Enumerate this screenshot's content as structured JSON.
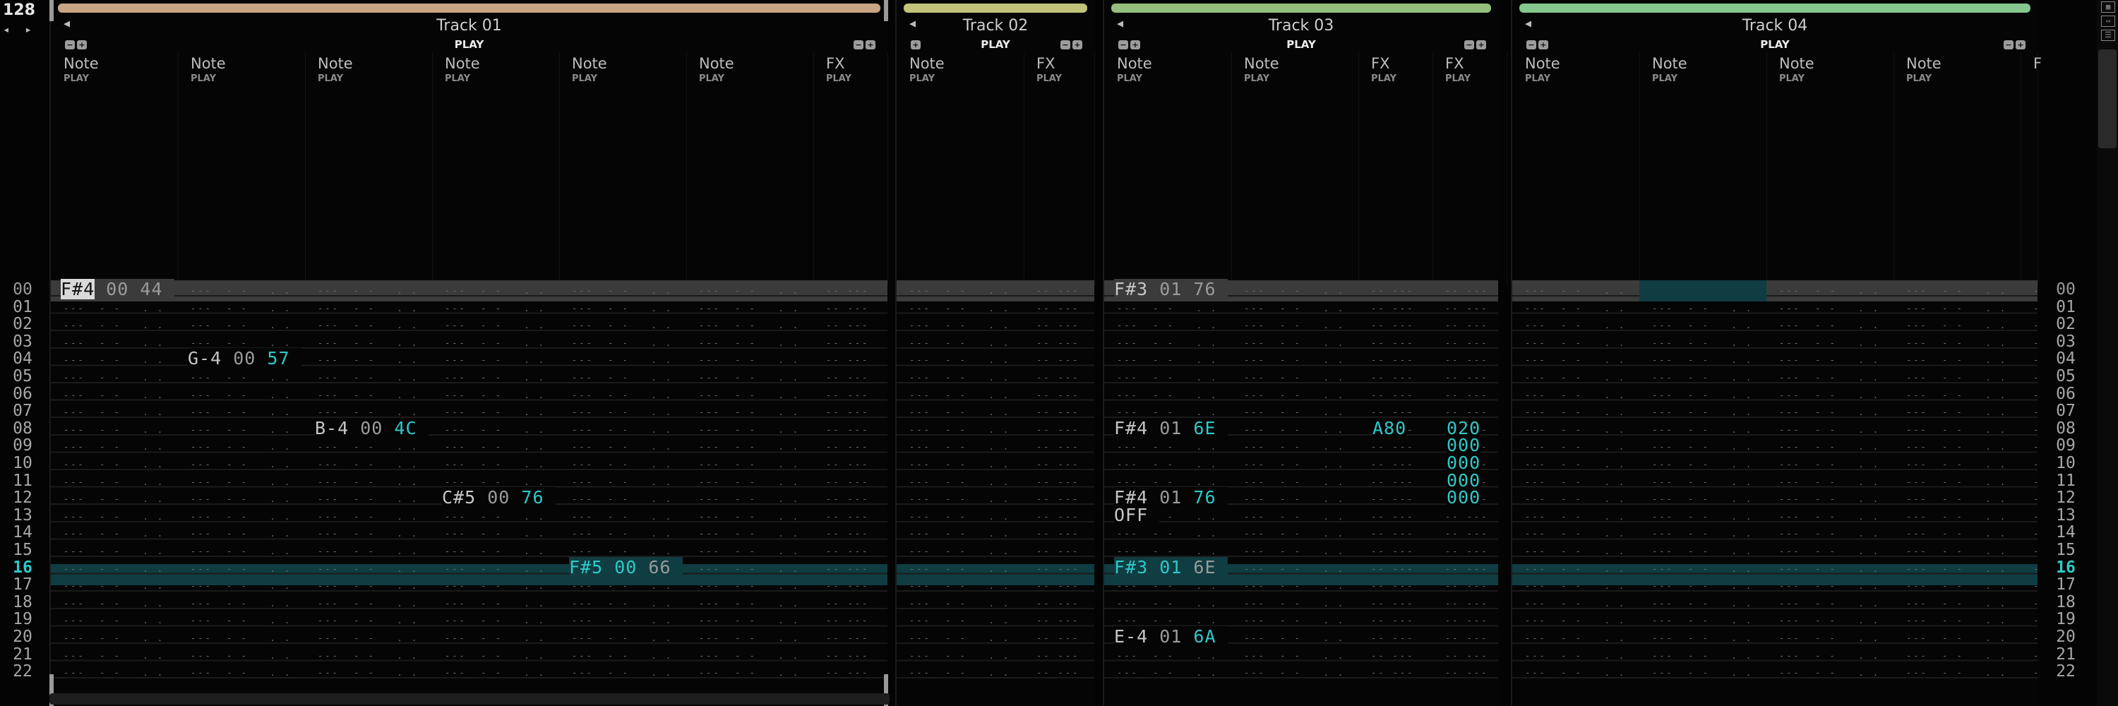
{
  "bpm": "128",
  "row_nav": "◂ ▸",
  "colors": {
    "track01": "#c8a583",
    "track02": "#c2c27b",
    "track03": "#95c07c",
    "track04": "#84c88f",
    "highlight": "#0f3d41",
    "value_cyan": "#2fc9c9"
  },
  "rows": [
    "00",
    "01",
    "02",
    "03",
    "04",
    "05",
    "06",
    "07",
    "08",
    "09",
    "10",
    "11",
    "12",
    "13",
    "14",
    "15",
    "16",
    "17",
    "18",
    "19",
    "20",
    "21",
    "22"
  ],
  "current_row": "16",
  "tracks": [
    {
      "title": "Track 01",
      "play": "PLAY",
      "columns": [
        "Note",
        "Note",
        "Note",
        "Note",
        "Note",
        "Note",
        "FX"
      ],
      "column_sub": "PLAY"
    },
    {
      "title": "Track 02",
      "play": "PLAY",
      "columns": [
        "Note",
        "FX"
      ],
      "column_sub": "PLAY"
    },
    {
      "title": "Track 03",
      "play": "PLAY",
      "columns": [
        "Note",
        "Note",
        "FX",
        "FX"
      ],
      "column_sub": "PLAY"
    },
    {
      "title": "Track 04",
      "play": "PLAY",
      "columns": [
        "Note",
        "Note",
        "Note",
        "Note",
        "F"
      ],
      "column_sub": "PLAY"
    }
  ],
  "cells": {
    "t1_r00": {
      "note": "F#4",
      "inst": "00",
      "vol": "44"
    },
    "t1_r04": {
      "note": "G-4",
      "inst": "00",
      "vol": "57"
    },
    "t1_r08": {
      "note": "B-4",
      "inst": "00",
      "vol": "4C"
    },
    "t1_r12": {
      "note": "C#5",
      "inst": "00",
      "vol": "76"
    },
    "t1_r16": {
      "note": "F#5",
      "inst": "00",
      "vol": "66"
    },
    "t3_r00": {
      "note": "F#3",
      "inst": "01",
      "vol": "76"
    },
    "t3_r08": {
      "note": "F#4",
      "inst": "01",
      "vol": "6E",
      "fx1": "A80",
      "fx2": "020"
    },
    "t3_r09": {
      "fx2": "000"
    },
    "t3_r10": {
      "fx2": "000"
    },
    "t3_r11": {
      "fx2": "000"
    },
    "t3_r12": {
      "note": "F#4",
      "inst": "01",
      "vol": "76",
      "fx2": "000"
    },
    "t3_r13": {
      "note": "OFF"
    },
    "t3_r16": {
      "note": "F#3",
      "inst": "01",
      "vol": "6E"
    },
    "t3_r20": {
      "note": "E-4",
      "inst": "01",
      "vol": "6A"
    }
  }
}
